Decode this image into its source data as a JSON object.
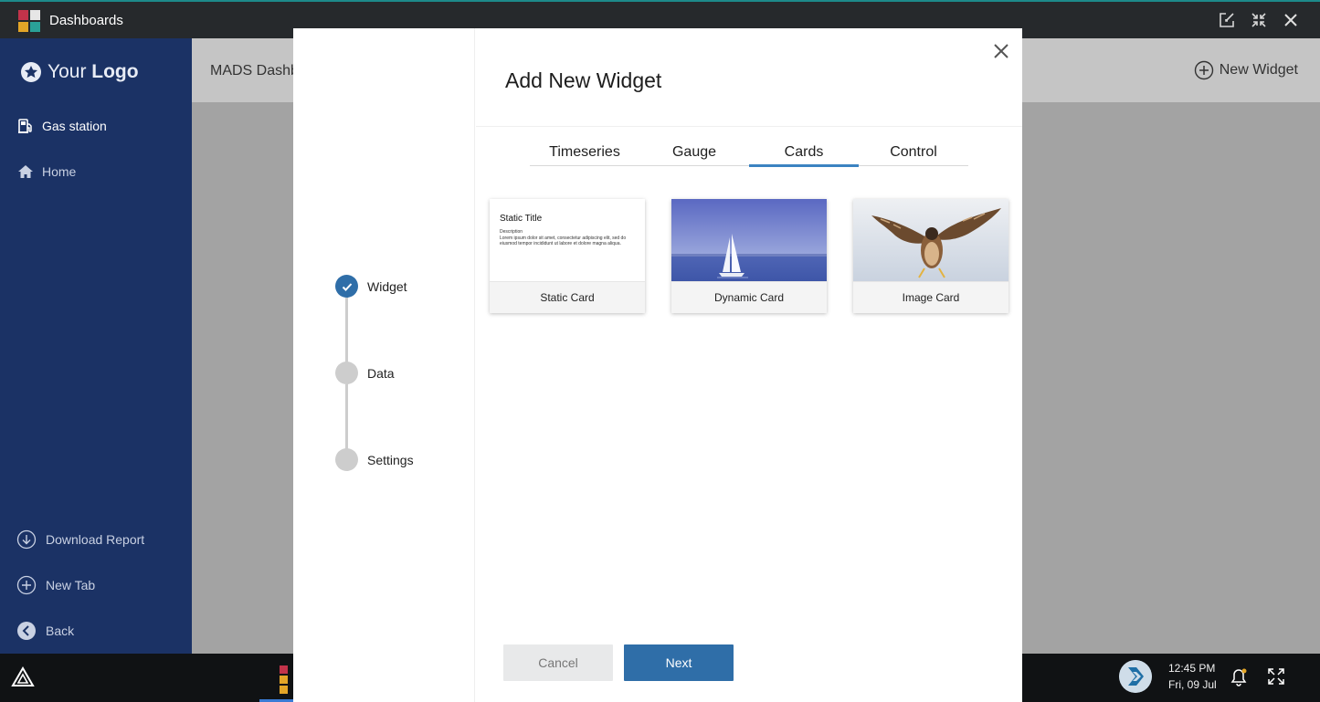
{
  "window": {
    "title": "Dashboards",
    "accent": "#1d8a8a"
  },
  "sidebar": {
    "logo_your": "Your",
    "logo_logo": "Logo",
    "items": [
      {
        "label": "Gas station",
        "icon": "gas-pump-icon"
      },
      {
        "label": "Home",
        "icon": "home-icon"
      }
    ],
    "bottom": [
      {
        "label": "Download Report",
        "icon": "download-circle-icon"
      },
      {
        "label": "New Tab",
        "icon": "plus-circle-icon"
      },
      {
        "label": "Back",
        "icon": "back-circle-icon"
      }
    ],
    "bg_color": "#1b3265"
  },
  "main": {
    "title": "MADS Dashb",
    "new_widget_label": "New Widget"
  },
  "modal": {
    "title": "Add New Widget",
    "steps": [
      {
        "label": "Widget",
        "status": "done"
      },
      {
        "label": "Data",
        "status": "pending"
      },
      {
        "label": "Settings",
        "status": "pending"
      }
    ],
    "tabs": [
      {
        "label": "Timeseries",
        "active": false
      },
      {
        "label": "Gauge",
        "active": false
      },
      {
        "label": "Cards",
        "active": true
      },
      {
        "label": "Control",
        "active": false
      }
    ],
    "cards": [
      {
        "label": "Static Card",
        "preview_title": "Static Title",
        "preview_desc_heading": "Description",
        "preview_desc": "Lorem ipsum dolor sit amet, consectetur adipiscing elit, sed do eiusmod tempor incididunt ut labore et dolore magna aliqua."
      },
      {
        "label": "Dynamic Card",
        "preview": "sailboat-image"
      },
      {
        "label": "Image Card",
        "preview": "falcon-image"
      }
    ],
    "cancel_label": "Cancel",
    "next_label": "Next",
    "primary_color": "#2f6ea8"
  },
  "taskbar": {
    "time": "12:45 PM",
    "date": "Fri, 09 Jul"
  }
}
